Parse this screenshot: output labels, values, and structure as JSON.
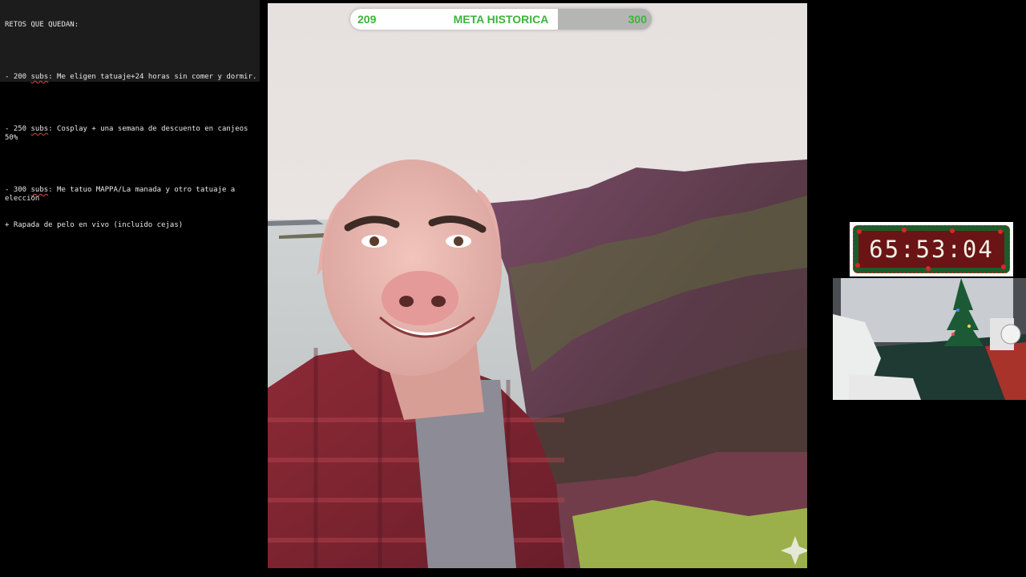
{
  "retos": {
    "title": "RETOS QUE QUEDAN:",
    "items": [
      {
        "prefix": "- 200 ",
        "subs": "subs",
        "rest": ": Me eligen tatuaje+24 horas sin comer y dormir."
      },
      {
        "prefix": "- 250 ",
        "subs": "subs",
        "rest": ": Cosplay + una semana de descuento en canjeos 50%"
      },
      {
        "prefix": "- 300 ",
        "subs": "subs",
        "rest": ": Me tatuo MAPPA/La manada y otro tatuaje a elección",
        "cont": "+ Rapada de pelo en vivo (incluido cejas)"
      }
    ]
  },
  "meta": {
    "current": "209",
    "title": "META HISTORICA",
    "goal": "300",
    "progress_fraction": 0.69,
    "text_color": "#3cb43c"
  },
  "timer": {
    "value": "65:53:04"
  },
  "icons": {
    "sparkle": "sparkle-icon"
  }
}
